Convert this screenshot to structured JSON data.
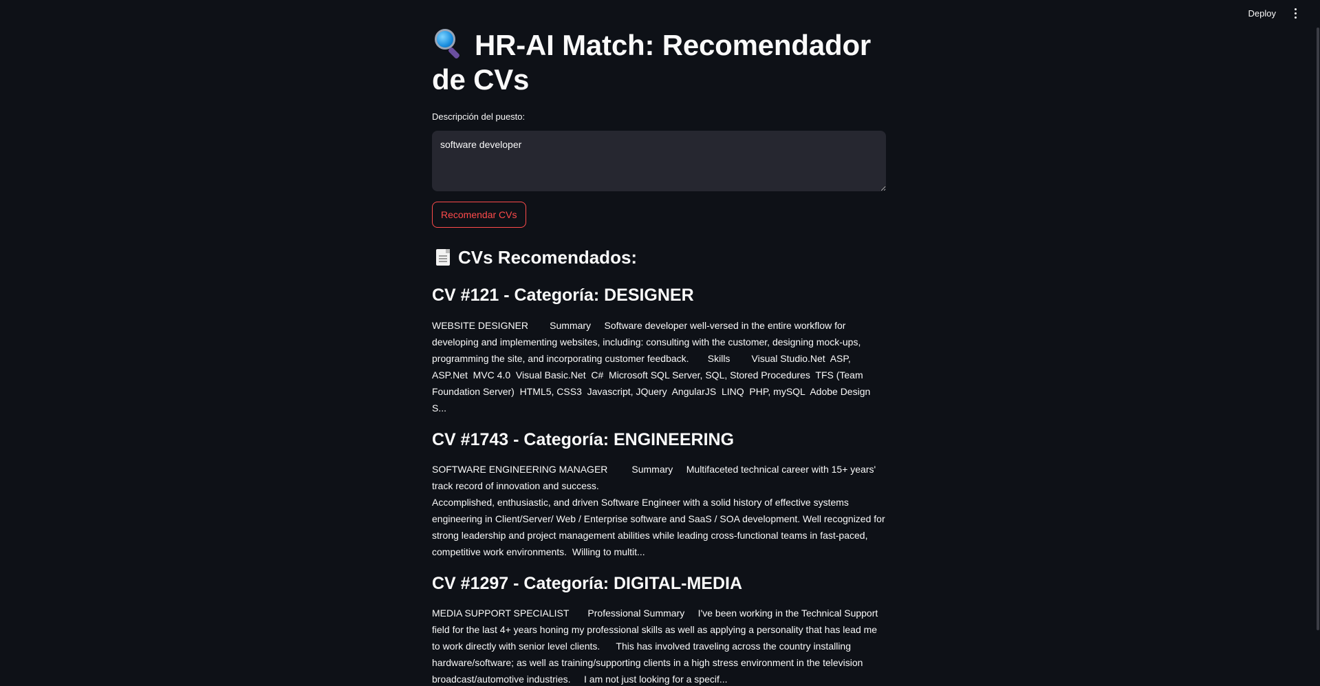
{
  "toolbar": {
    "deploy_label": "Deploy",
    "menu_icon": "more-vertical-icon"
  },
  "main": {
    "title_icon": "magnifying-glass-icon",
    "title": "HR-AI Match: Recomendador de CVs",
    "description_label": "Descripción del puesto:",
    "description_value": "software developer",
    "recommend_button": "Recomendar CVs",
    "results_icon": "document-icon",
    "results_heading": "CVs Recomendados:",
    "cvs": [
      {
        "heading": "CV #121 - Categoría: DESIGNER",
        "text": "WEBSITE DESIGNER        Summary     Software developer well-versed in the entire workflow for developing and implementing websites, including: consulting with the customer, designing mock-ups, programming the site, and incorporating customer feedback.       Skills        Visual Studio.Net  ASP, ASP.Net  MVC 4.0  Visual Basic.Net  C#  Microsoft SQL Server, SQL, Stored Procedures  TFS (Team Foundation Server)  HTML5, CSS3  Javascript, JQuery  AngularJS  LINQ  PHP, mySQL  Adobe Design S..."
      },
      {
        "heading": "CV #1743 - Categoría: ENGINEERING",
        "text": "SOFTWARE ENGINEERING MANAGER         Summary     Multifaceted technical career with 15+ years' track record of innovation and success.\nAccomplished, enthusiastic, and driven Software Engineer with a solid history of effective systems engineering in Client/Server/ Web / Enterprise software and SaaS / SOA development. Well recognized for strong leadership and project management abilities while leading cross-functional teams in fast-paced, competitive work environments.  Willing to multit..."
      },
      {
        "heading": "CV #1297 - Categoría: DIGITAL-MEDIA",
        "text": "MEDIA SUPPORT SPECIALIST       Professional Summary     I've been working in the Technical Support field for the last 4+ years honing my professional skills as well as applying a personality that has lead me to work directly with senior level clients.      This has involved traveling across the country installing hardware/software; as well as training/supporting clients in a high stress environment in the television broadcast/automotive industries.     I am not just looking for a specif..."
      }
    ]
  },
  "colors": {
    "background": "#0e1117",
    "input_background": "#262730",
    "accent": "#ff4b4b",
    "text": "#fafafa"
  }
}
